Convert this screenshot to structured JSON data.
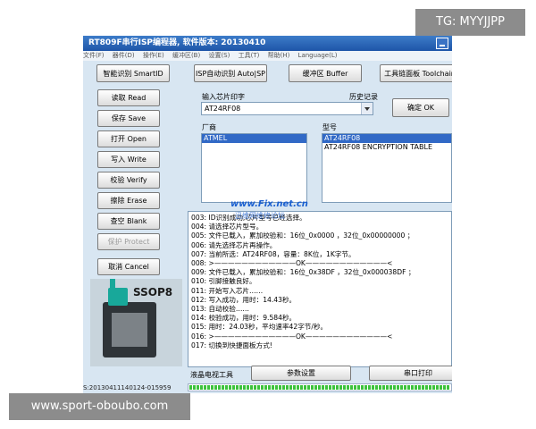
{
  "window": {
    "title": "RT809F串行ISP编程器, 软件版本: 20130410"
  },
  "menu": [
    "文件(F)",
    "器件(D)",
    "操作(E)",
    "缓冲区(B)",
    "设置(S)",
    "工具(T)",
    "帮助(H)",
    "Language(L)"
  ],
  "toolbar": {
    "smart_id": "智能识别 SmartID",
    "isp_auto": "ISP自动识别 Auto|SP",
    "buffer": "缓冲区 Buffer",
    "toolchain": "工具链面板 Toolchain"
  },
  "side_buttons": {
    "read": "读取 Read",
    "save": "保存 Save",
    "open": "打开 Open",
    "write": "写入 Write",
    "verify": "校验 Verify",
    "erase": "擦除 Erase",
    "blank": "查空 Blank",
    "protect": "保护 Protect",
    "cancel": "取消 Cancel"
  },
  "chip_input": {
    "label": "输入芯片印字",
    "value": "AT24RF08",
    "history_label": "历史记录",
    "confirm_button": "确定 OK"
  },
  "manufacturer": {
    "label": "厂商",
    "items": [
      "ATMEL"
    ]
  },
  "model": {
    "label": "型号",
    "items": [
      "AT24RF08",
      "AT24RF08 ENCRYPTION TABLE"
    ]
  },
  "chip_image_label": "SSOP8",
  "log_lines": [
    "003: ID识别成功,芯片型号已经选择。",
    "004: 请选择芯片型号。",
    "005: 文件已载入，累加校验和：16位_0x0000 ，32位_0x00000000 ；",
    "006: 请先选择芯片再操作。",
    "007: 当前所选：AT24RF08，容量：8K位，1K字节。",
    "008: >————————————OK————————————<",
    "009: 文件已载入，累加校验和：16位_0x38DF ，32位_0x000038DF ；",
    "010: 引脚接触良好。",
    "011: 开始写入芯片……",
    "012: 写入成功，用时：14.43秒。",
    "013: 自动校验……",
    "014: 校验成功，用时：9.584秒。",
    "015: 用时：24.03秒，平均速率42字节/秒。",
    "016: >————————————OK————————————<",
    "017: 切换到快捷面板方式!"
  ],
  "bottom": {
    "lcd_tool": "液晶电视工具",
    "params_button": "参数设置",
    "serial_button": "串口打印",
    "progress_fraction": 1.0,
    "status_text": "S:20130411140124-015959"
  },
  "watermarks": {
    "top_right": "TG: MYYJJPP",
    "bottom_left": "www.sport-oboubo.com",
    "site": "www.Fix.net.cn",
    "site_sub": "迅维网维修论坛"
  },
  "colors": {
    "titlebar": "#1e55a8",
    "selection": "#3169c6",
    "progress": "#3cc23c",
    "window_bg": "#d8e6f2"
  }
}
